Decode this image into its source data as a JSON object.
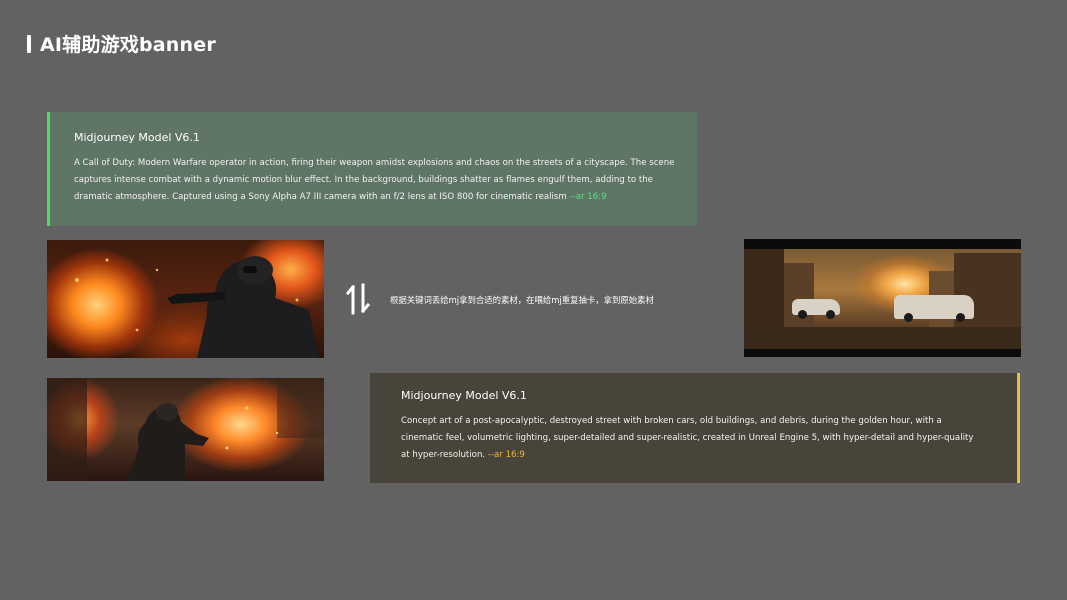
{
  "header": {
    "title": "AI辅助游戏banner"
  },
  "prompt_top": {
    "model": "Midjourney Model V6.1",
    "text": "A Call of Duty: Modern Warfare operator in action, firing their weapon amidst explosions and chaos on the streets of a cityscape. The scene captures intense combat with a dynamic motion blur effect. In the background, buildings shatter as flames engulf them, adding to the dramatic atmosphere. Captured using a Sony Alpha A7 III camera with an f/2 lens at ISO 800 for cinematic realism ",
    "param": "--ar 16:9",
    "accent_color": "#4cde6c",
    "background_color": "#5f7565"
  },
  "prompt_bottom": {
    "model": "Midjourney Model V6.1",
    "text": "Concept art of a post-apocalyptic, destroyed street with broken cars, old buildings, and debris, during the golden hour, with a cinematic feel, volumetric lighting, super-detailed and super-realistic, created in Unreal Engine 5, with hyper-detail and hyper-quality at hyper-resolution. ",
    "param": "--ar 16:9",
    "accent_color": "#f1b83a",
    "background_color": "#49443a"
  },
  "middle": {
    "icon": "swap-vertical-icon",
    "caption": "根据关键词丢给mj拿到合适的素材，在喂给mj重复抽卡，拿到原始素材"
  },
  "images": {
    "soldier_one": "soldier-explosion-image",
    "soldier_two": "soldier-street-fire-image",
    "ruined_street": "ruined-street-image"
  }
}
